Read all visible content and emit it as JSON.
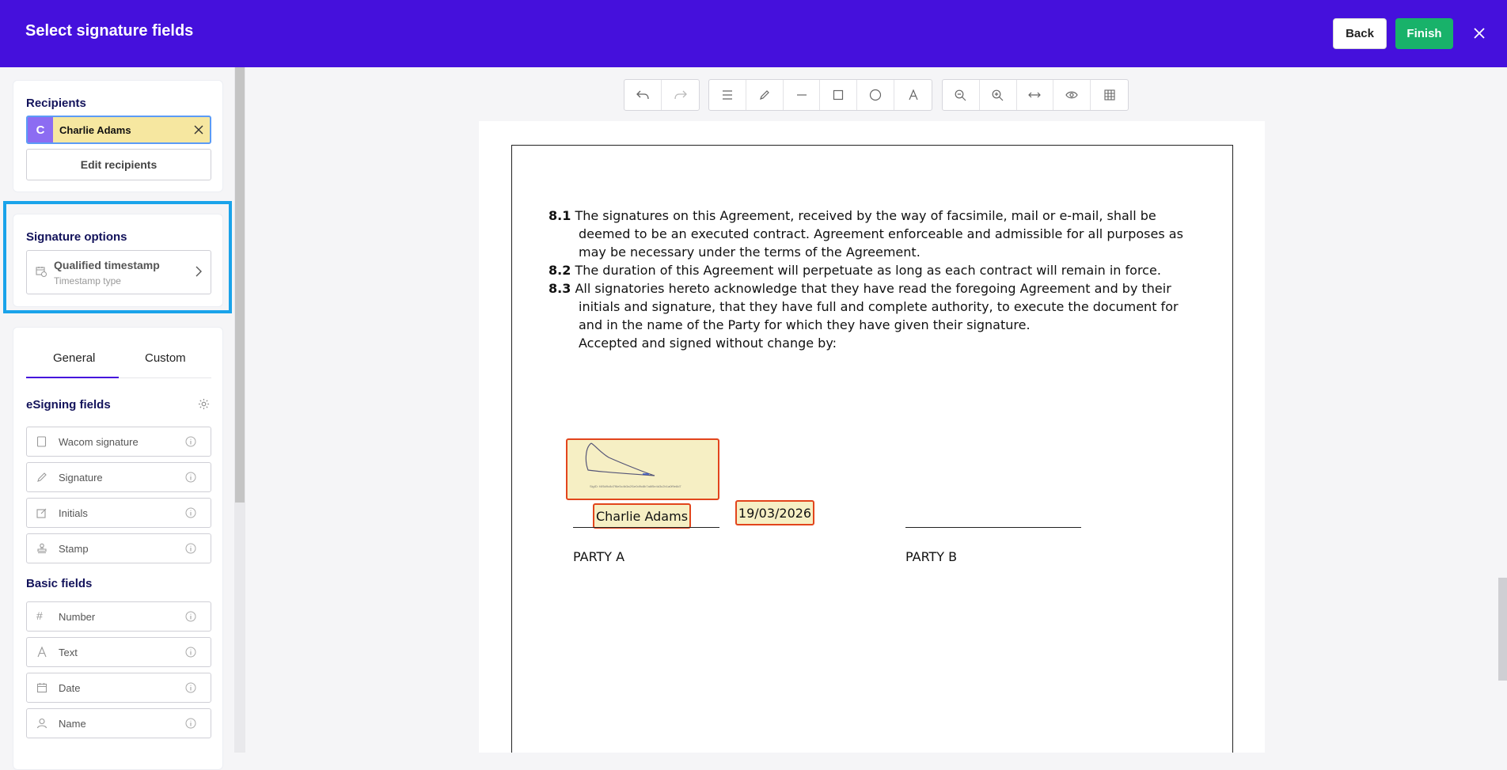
{
  "header": {
    "title": "Select signature fields",
    "back_label": "Back",
    "finish_label": "Finish"
  },
  "recipients": {
    "title": "Recipients",
    "selected": {
      "initial": "C",
      "name": "Charlie Adams"
    },
    "edit_label": "Edit recipients"
  },
  "signature_options": {
    "title": "Signature options",
    "timestamp_title": "Qualified timestamp",
    "timestamp_sub": "Timestamp type"
  },
  "fields_panel": {
    "tabs": [
      {
        "label": "General"
      },
      {
        "label": "Custom"
      }
    ],
    "esigning_title": "eSigning fields",
    "esigning_fields": [
      {
        "label": "Wacom signature",
        "icon": "tablet-icon"
      },
      {
        "label": "Signature",
        "icon": "pen-icon"
      },
      {
        "label": "Initials",
        "icon": "edit-icon"
      },
      {
        "label": "Stamp",
        "icon": "stamp-icon"
      }
    ],
    "basic_title": "Basic fields",
    "basic_fields": [
      {
        "label": "Number",
        "icon": "hash-icon"
      },
      {
        "label": "Text",
        "icon": "text-icon"
      },
      {
        "label": "Date",
        "icon": "calendar-icon"
      },
      {
        "label": "Name",
        "icon": "person-icon"
      }
    ]
  },
  "document": {
    "clauses": [
      {
        "num": "8.1",
        "lines": [
          "The signatures on this Agreement, received by the way of facsimile, mail or e-mail, shall be",
          "deemed to be an executed contract. Agreement enforceable and admissible for all purposes as",
          "may be necessary under the terms of the Agreement."
        ]
      },
      {
        "num": "8.2",
        "lines": [
          "The duration of this Agreement will perpetuate as long as each contract will remain in force."
        ]
      },
      {
        "num": "8.3",
        "lines": [
          "All signatories hereto acknowledge that they have read the foregoing Agreement and by their",
          "initials and signature, that they have full and complete authority, to execute the document for",
          "and in the name of the Party for which they have given their signature.",
          "Accepted and signed without change by:"
        ]
      }
    ],
    "sig_hash": "SigID: f4f5d9c8d7f6e5c4b3a2f1e0d9c8b7a6f5e4d3c2b1a0f9e8d7",
    "signer_name": "Charlie Adams",
    "date": "19/03/2026",
    "party_a": "PARTY A",
    "party_b": "PARTY B"
  },
  "colors": {
    "brand": "#4510dc",
    "finish": "#18b26a",
    "highlight": "#1aa3ea",
    "field_border": "#e2451c",
    "field_fill": "#f6efc4"
  }
}
